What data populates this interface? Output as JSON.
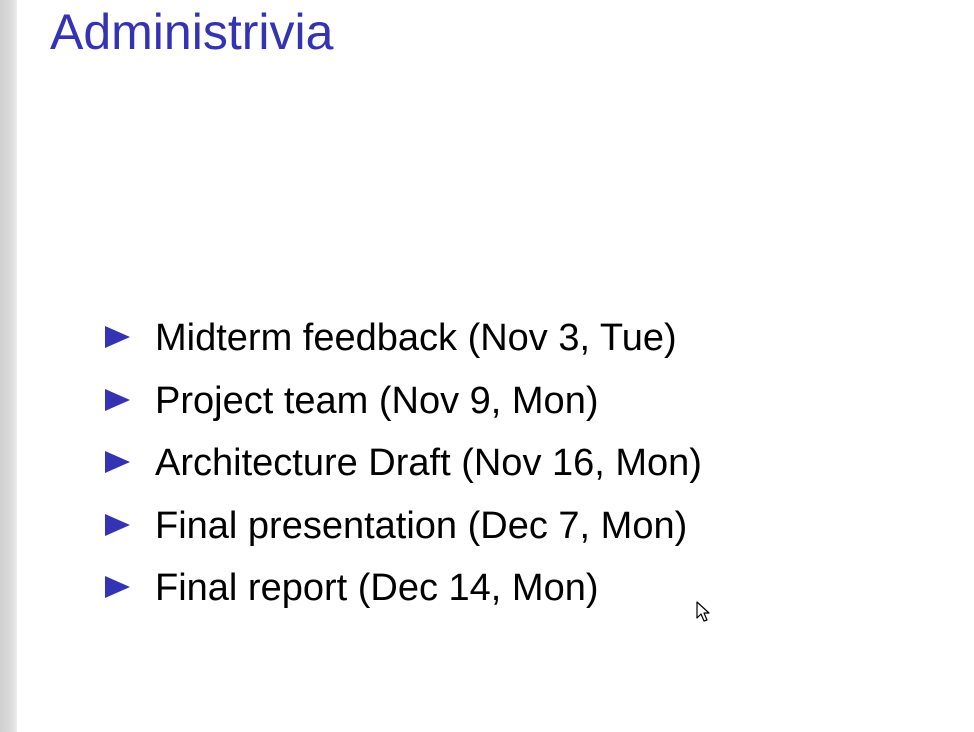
{
  "slide": {
    "title": "Administrivia",
    "bullets": [
      "Midterm feedback (Nov 3, Tue)",
      "Project team (Nov 9, Mon)",
      "Architecture Draft (Nov 16, Mon)",
      "Final presentation (Dec 7, Mon)",
      "Final report (Dec 14, Mon)"
    ]
  },
  "colors": {
    "title": "#3333b3",
    "bullet_marker": "#3333b3",
    "text": "#000000"
  },
  "icons": {
    "bullet": "triangle-right-icon",
    "pointer": "mouse-pointer-icon"
  }
}
